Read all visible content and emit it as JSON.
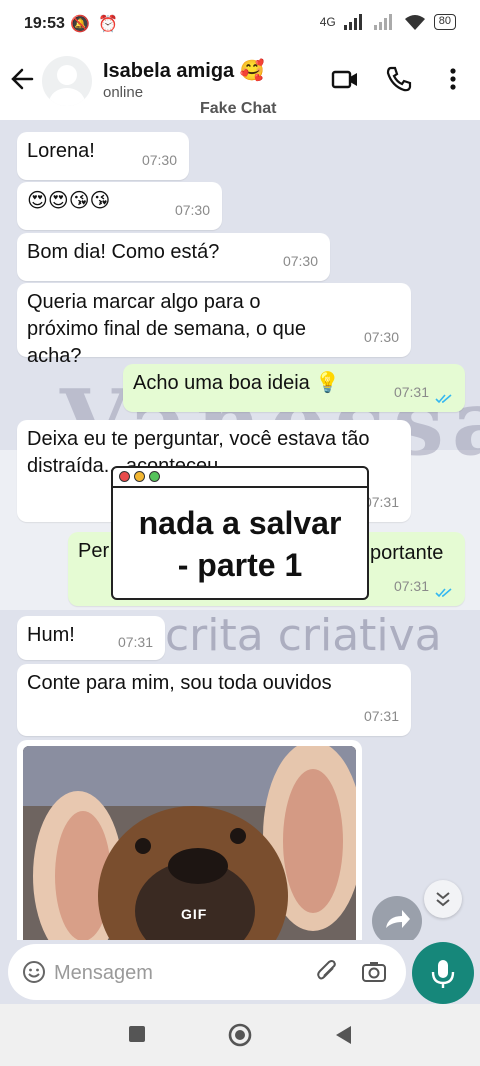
{
  "status_bar": {
    "time": "19:53",
    "left_icons": "🔕 ⏰",
    "network": "4G",
    "battery": "80"
  },
  "header": {
    "contact_name": "Isabela amiga 🥰",
    "contact_status": "online",
    "fake_label": "Fake Chat"
  },
  "watermark": {
    "line1": "Vanessa",
    "line2": "escrita criativa"
  },
  "messages": [
    {
      "side": "in",
      "text": "Lorena!",
      "time": "07:30"
    },
    {
      "side": "in",
      "text": "😍😍😘😘",
      "time": "07:30"
    },
    {
      "side": "in",
      "text": "Bom dia! Como está?",
      "time": "07:30"
    },
    {
      "side": "in",
      "text": "Queria marcar algo para o próximo final de semana, o que acha?",
      "time": "07:30"
    },
    {
      "side": "out",
      "text": "Acho uma boa ideia 💡",
      "time": "07:31"
    },
    {
      "side": "in",
      "text": "Deixa eu te perguntar, você estava tão distraída... aconteceu",
      "time": "07:31"
    },
    {
      "side": "out",
      "text": "Per",
      "text_right": "portante",
      "time": "07:31"
    },
    {
      "side": "in",
      "text": "Hum!",
      "time": "07:31"
    },
    {
      "side": "in",
      "text": "Conte para mim, sou toda ouvidos",
      "time": "07:31"
    }
  ],
  "overlay": {
    "title_line1": "nada a salvar",
    "title_line2": "- parte 1"
  },
  "gif": {
    "label": "GIF"
  },
  "input": {
    "placeholder": "Mensagem"
  },
  "colors": {
    "chat_bg": "#dfe2ec",
    "outgoing_bubble": "#e5fbd3",
    "mic_button": "#16877a",
    "read_ticks": "#34b7f1"
  }
}
